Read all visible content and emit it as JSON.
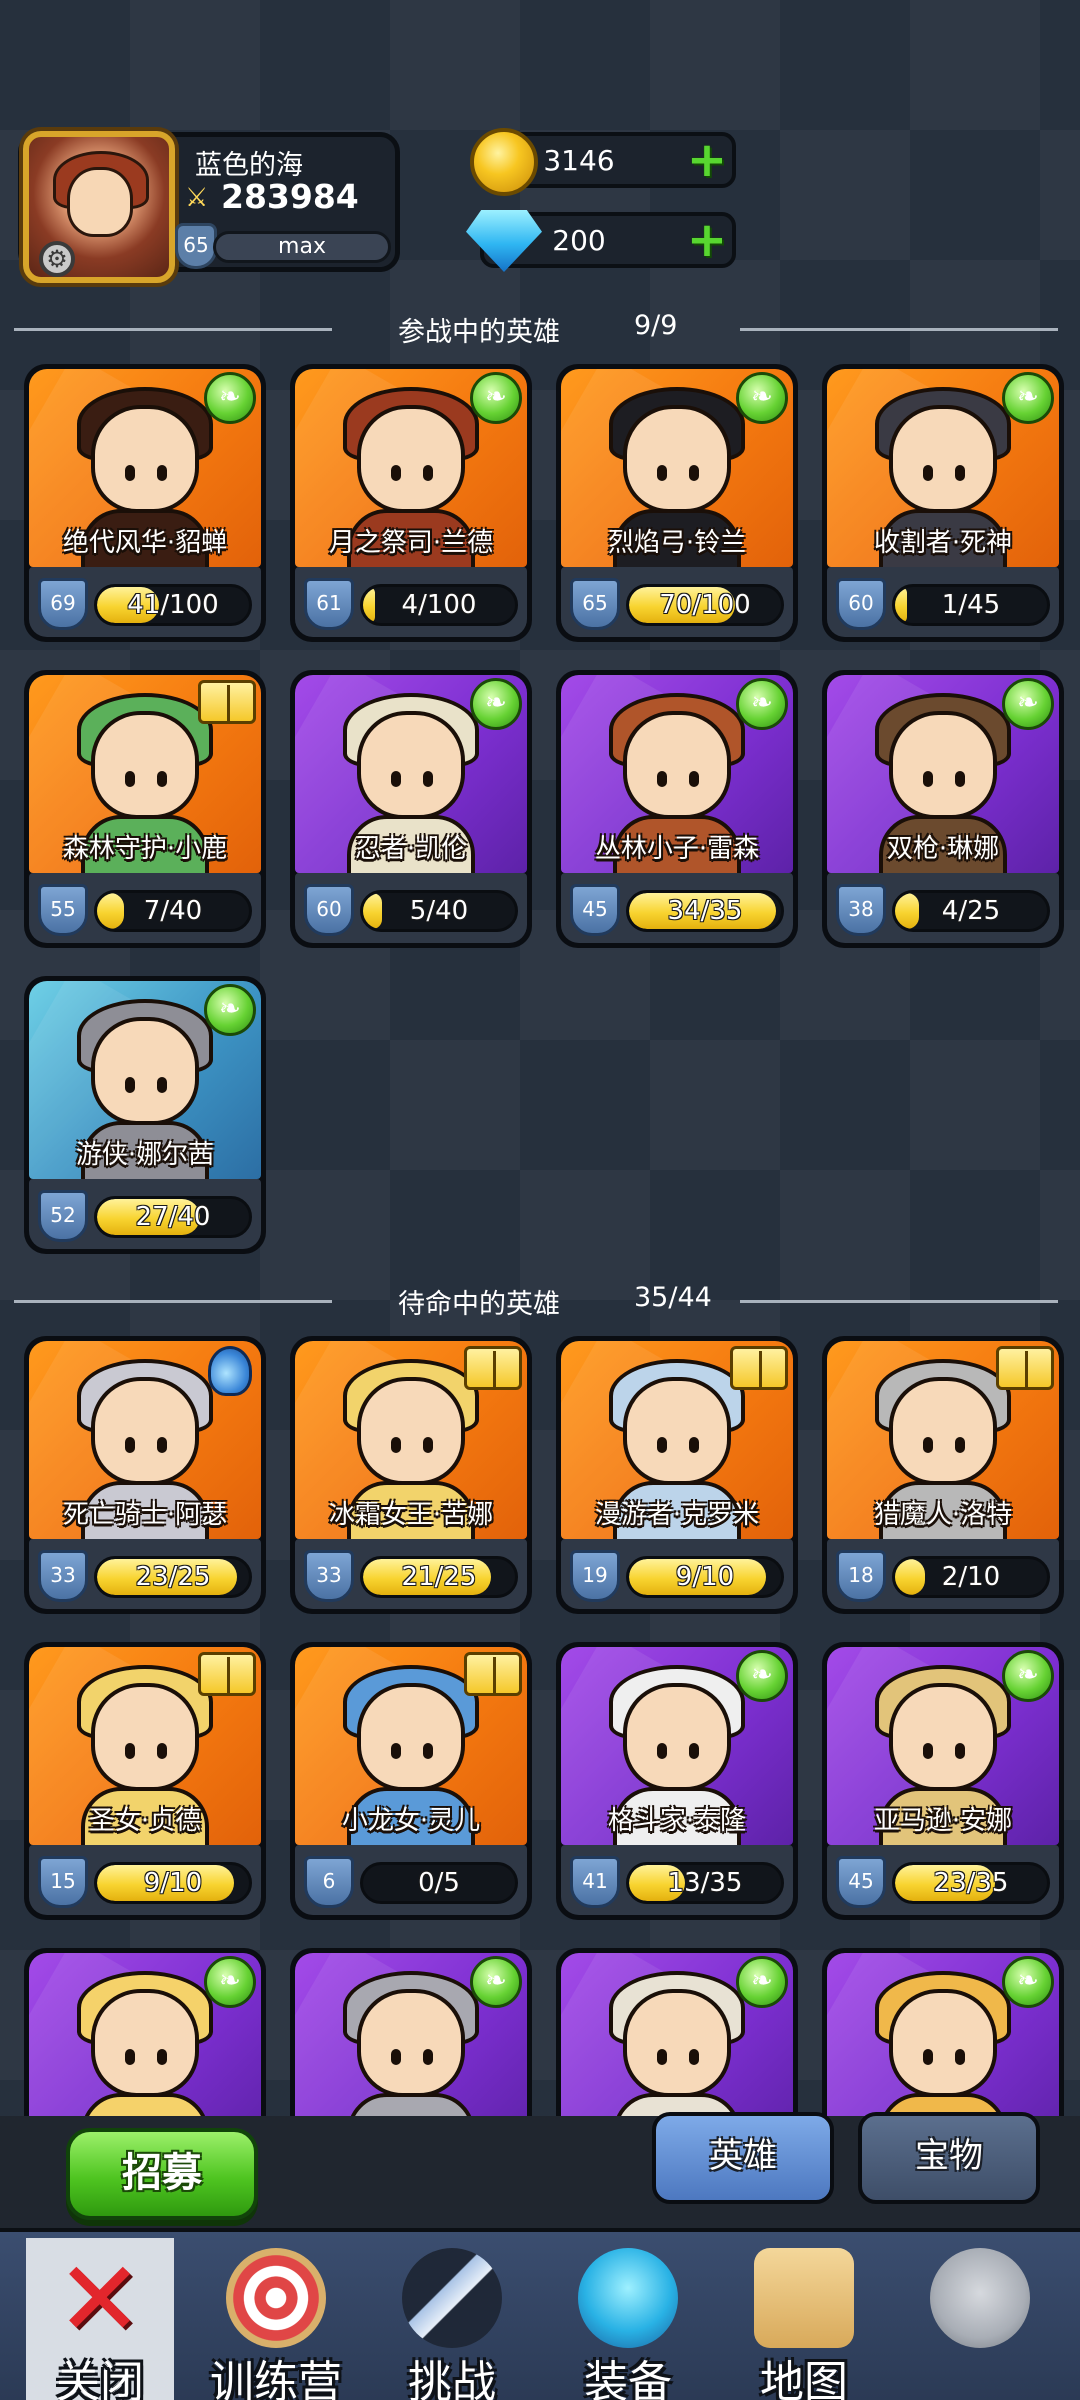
{
  "player": {
    "name": "蓝色的海",
    "power": "283984",
    "level": "65",
    "xp_label": "max",
    "gold": "3146",
    "gems": "200"
  },
  "active_section": {
    "title": "参战中的英雄",
    "count": "9/9"
  },
  "reserve_section": {
    "title": "待命中的英雄",
    "count": "35/44"
  },
  "active_heroes": [
    {
      "name": "绝代风华·貂蝉",
      "level": "69",
      "progress": "41/100",
      "fraction": 0.41,
      "rarity": "orange",
      "badge": "wing",
      "hair": "#3a1d12"
    },
    {
      "name": "月之祭司·兰德",
      "level": "61",
      "progress": "4/100",
      "fraction": 0.04,
      "rarity": "orange",
      "badge": "wing",
      "hair": "#9b3a1f"
    },
    {
      "name": "烈焰弓·铃兰",
      "level": "65",
      "progress": "70/100",
      "fraction": 0.7,
      "rarity": "orange",
      "badge": "wing",
      "hair": "#1d1d22"
    },
    {
      "name": "收割者·死神",
      "level": "60",
      "progress": "1/45",
      "fraction": 0.02,
      "rarity": "orange",
      "badge": "wing",
      "hair": "#3a3a44"
    },
    {
      "name": "森林守护·小鹿",
      "level": "55",
      "progress": "7/40",
      "fraction": 0.175,
      "rarity": "orange",
      "badge": "book",
      "hair": "#5bb05a"
    },
    {
      "name": "忍者·凯伦",
      "level": "60",
      "progress": "5/40",
      "fraction": 0.125,
      "rarity": "purple",
      "badge": "wing",
      "hair": "#e9e2c9"
    },
    {
      "name": "丛林小子·雷森",
      "level": "45",
      "progress": "34/35",
      "fraction": 0.97,
      "rarity": "purple",
      "badge": "wing",
      "hair": "#b0552a"
    },
    {
      "name": "双枪·琳娜",
      "level": "38",
      "progress": "4/25",
      "fraction": 0.16,
      "rarity": "purple",
      "badge": "wing",
      "hair": "#6b4a2e"
    },
    {
      "name": "游侠·娜尔茜",
      "level": "52",
      "progress": "27/40",
      "fraction": 0.675,
      "rarity": "blue",
      "badge": "wing",
      "hair": "#8e8e96"
    }
  ],
  "reserve_heroes": [
    {
      "name": "死亡骑士·阿瑟",
      "level": "33",
      "progress": "23/25",
      "fraction": 0.92,
      "rarity": "orange",
      "badge": "potion",
      "hair": "#c9c9d2"
    },
    {
      "name": "冰霜女王·苦娜",
      "level": "33",
      "progress": "21/25",
      "fraction": 0.84,
      "rarity": "orange",
      "badge": "book",
      "hair": "#f2d36b"
    },
    {
      "name": "漫游者·克罗米",
      "level": "19",
      "progress": "9/10",
      "fraction": 0.9,
      "rarity": "orange",
      "badge": "book",
      "hair": "#bcd4ea"
    },
    {
      "name": "猎魔人·洛特",
      "level": "18",
      "progress": "2/10",
      "fraction": 0.2,
      "rarity": "orange",
      "badge": "book",
      "hair": "#b8b8b8"
    },
    {
      "name": "圣女·贞德",
      "level": "15",
      "progress": "9/10",
      "fraction": 0.9,
      "rarity": "orange",
      "badge": "book",
      "hair": "#f2d36b"
    },
    {
      "name": "小龙女·灵儿",
      "level": "6",
      "progress": "0/5",
      "fraction": 0.0,
      "rarity": "orange",
      "badge": "book",
      "hair": "#5a9ad8"
    },
    {
      "name": "格斗家·泰隆",
      "level": "41",
      "progress": "13/35",
      "fraction": 0.37,
      "rarity": "purple",
      "badge": "wing",
      "hair": "#efefef"
    },
    {
      "name": "亚马逊·安娜",
      "level": "45",
      "progress": "23/35",
      "fraction": 0.66,
      "rarity": "purple",
      "badge": "wing",
      "hair": "#e2c47a"
    },
    {
      "name": "",
      "level": "",
      "progress": "",
      "fraction": 0,
      "rarity": "purple",
      "badge": "wing",
      "hair": "#f5d26a"
    },
    {
      "name": "",
      "level": "",
      "progress": "",
      "fraction": 0,
      "rarity": "purple",
      "badge": "wing",
      "hair": "#a8a8b0"
    },
    {
      "name": "",
      "level": "",
      "progress": "",
      "fraction": 0,
      "rarity": "purple",
      "badge": "wing",
      "hair": "#e8e2d4"
    },
    {
      "name": "",
      "level": "",
      "progress": "",
      "fraction": 0,
      "rarity": "purple",
      "badge": "wing",
      "hair": "#f0b84a"
    }
  ],
  "actions": {
    "recruit": "招募"
  },
  "tabs": {
    "heroes": "英雄",
    "treasures": "宝物"
  },
  "nav": {
    "close": "关闭",
    "training": "训练营",
    "challenge": "挑战",
    "equipment": "装备",
    "map": "地图"
  },
  "colors": {
    "orange_card": "#f57a10",
    "purple_card": "#7d2fd1",
    "blue_card": "#3d94c4",
    "progress_fill": "#f8d430",
    "plus_green": "#58d630"
  }
}
